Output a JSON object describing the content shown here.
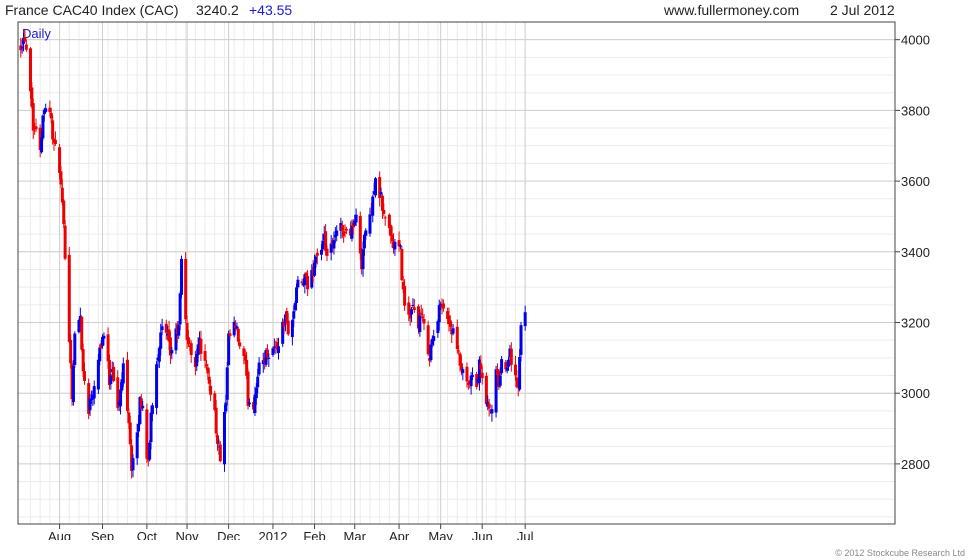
{
  "header": {
    "name": "France CAC40 Index (CAC)",
    "value": "3240.2",
    "change": "+43.55",
    "site": "www.fullermoney.com",
    "date": "2 Jul 2012"
  },
  "footer": {
    "credit": "© 2012 Stockcube Research Ltd"
  },
  "colors": {
    "up": "#0000ee",
    "down": "#ee0000",
    "grid": "#cfcfcf",
    "axis": "#444444",
    "label_blue": "#1a1acc"
  },
  "chart_data": {
    "type": "candlestick",
    "frequency_label": "Daily",
    "y_ticks": [
      "4000",
      "3800",
      "3600",
      "3400",
      "3200",
      "3000",
      "2800"
    ],
    "ylim": [
      2630,
      4050
    ],
    "x_ticks": [
      "Aug",
      "Sep",
      "Oct",
      "Nov",
      "Dec",
      "2012",
      "Feb",
      "Mar",
      "Apr",
      "May",
      "Jun",
      "Jul"
    ],
    "x_tick_dates": [
      "2011-08-01",
      "2011-09-01",
      "2011-10-03",
      "2011-11-01",
      "2011-12-01",
      "2012-01-02",
      "2012-02-01",
      "2012-03-01",
      "2012-04-02",
      "2012-05-02",
      "2012-06-01",
      "2012-07-02"
    ],
    "grid": true,
    "y_axis_side": "right",
    "close_path": [
      [
        "2011-07-04",
        3990
      ],
      [
        "2011-07-07",
        4010
      ],
      [
        "2011-07-11",
        3870
      ],
      [
        "2011-07-13",
        3760
      ],
      [
        "2011-07-18",
        3700
      ],
      [
        "2011-07-21",
        3820
      ],
      [
        "2011-07-25",
        3800
      ],
      [
        "2011-07-28",
        3700
      ],
      [
        "2011-08-01",
        3640
      ],
      [
        "2011-08-03",
        3520
      ],
      [
        "2011-08-05",
        3400
      ],
      [
        "2011-08-08",
        3160
      ],
      [
        "2011-08-10",
        3000
      ],
      [
        "2011-08-12",
        3160
      ],
      [
        "2011-08-16",
        3220
      ],
      [
        "2011-08-18",
        3060
      ],
      [
        "2011-08-22",
        2960
      ],
      [
        "2011-08-25",
        3010
      ],
      [
        "2011-08-30",
        3130
      ],
      [
        "2011-09-02",
        3170
      ],
      [
        "2011-09-06",
        3040
      ],
      [
        "2011-09-08",
        3080
      ],
      [
        "2011-09-12",
        2950
      ],
      [
        "2011-09-14",
        3000
      ],
      [
        "2011-09-16",
        3080
      ],
      [
        "2011-09-20",
        2930
      ],
      [
        "2011-09-22",
        2790
      ],
      [
        "2011-09-26",
        2870
      ],
      [
        "2011-09-28",
        2980
      ],
      [
        "2011-09-30",
        2960
      ],
      [
        "2011-10-04",
        2790
      ],
      [
        "2011-10-06",
        2940
      ],
      [
        "2011-10-10",
        3090
      ],
      [
        "2011-10-12",
        3140
      ],
      [
        "2011-10-14",
        3180
      ],
      [
        "2011-10-18",
        3150
      ],
      [
        "2011-10-20",
        3110
      ],
      [
        "2011-10-24",
        3170
      ],
      [
        "2011-10-26",
        3180
      ],
      [
        "2011-10-28",
        3370
      ],
      [
        "2011-11-01",
        3160
      ],
      [
        "2011-11-03",
        3120
      ],
      [
        "2011-11-07",
        3090
      ],
      [
        "2011-11-09",
        3150
      ],
      [
        "2011-11-11",
        3130
      ],
      [
        "2011-11-15",
        3060
      ],
      [
        "2011-11-17",
        3030
      ],
      [
        "2011-11-21",
        2950
      ],
      [
        "2011-11-23",
        2850
      ],
      [
        "2011-11-25",
        2820
      ],
      [
        "2011-11-29",
        2970
      ],
      [
        "2011-12-01",
        3150
      ],
      [
        "2011-12-05",
        3190
      ],
      [
        "2011-12-07",
        3170
      ],
      [
        "2011-12-09",
        3130
      ],
      [
        "2011-12-13",
        3080
      ],
      [
        "2011-12-15",
        2980
      ],
      [
        "2011-12-19",
        2970
      ],
      [
        "2011-12-21",
        3030
      ],
      [
        "2011-12-23",
        3070
      ],
      [
        "2011-12-28",
        3110
      ],
      [
        "2012-01-03",
        3130
      ],
      [
        "2012-01-05",
        3130
      ],
      [
        "2012-01-09",
        3190
      ],
      [
        "2012-01-11",
        3210
      ],
      [
        "2012-01-13",
        3180
      ],
      [
        "2012-01-17",
        3220
      ],
      [
        "2012-01-19",
        3300
      ],
      [
        "2012-01-23",
        3310
      ],
      [
        "2012-01-25",
        3320
      ],
      [
        "2012-01-27",
        3300
      ],
      [
        "2012-01-31",
        3350
      ],
      [
        "2012-02-02",
        3390
      ],
      [
        "2012-02-06",
        3400
      ],
      [
        "2012-02-08",
        3430
      ],
      [
        "2012-02-10",
        3390
      ],
      [
        "2012-02-14",
        3410
      ],
      [
        "2012-02-16",
        3440
      ],
      [
        "2012-02-20",
        3470
      ],
      [
        "2012-02-22",
        3460
      ],
      [
        "2012-02-24",
        3450
      ],
      [
        "2012-02-28",
        3470
      ],
      [
        "2012-03-02",
        3490
      ],
      [
        "2012-03-06",
        3370
      ],
      [
        "2012-03-08",
        3450
      ],
      [
        "2012-03-12",
        3490
      ],
      [
        "2012-03-14",
        3570
      ],
      [
        "2012-03-16",
        3590
      ],
      [
        "2012-03-20",
        3550
      ],
      [
        "2012-03-22",
        3500
      ],
      [
        "2012-03-26",
        3470
      ],
      [
        "2012-03-28",
        3420
      ],
      [
        "2012-03-30",
        3420
      ],
      [
        "2012-04-03",
        3400
      ],
      [
        "2012-04-05",
        3280
      ],
      [
        "2012-04-10",
        3200
      ],
      [
        "2012-04-12",
        3240
      ],
      [
        "2012-04-16",
        3200
      ],
      [
        "2012-04-18",
        3220
      ],
      [
        "2012-04-20",
        3180
      ],
      [
        "2012-04-24",
        3110
      ],
      [
        "2012-04-26",
        3150
      ],
      [
        "2012-04-30",
        3200
      ],
      [
        "2012-05-02",
        3270
      ],
      [
        "2012-05-04",
        3240
      ],
      [
        "2012-05-08",
        3200
      ],
      [
        "2012-05-10",
        3180
      ],
      [
        "2012-05-14",
        3120
      ],
      [
        "2012-05-16",
        3080
      ],
      [
        "2012-05-18",
        3050
      ],
      [
        "2012-05-22",
        3010
      ],
      [
        "2012-05-24",
        3040
      ],
      [
        "2012-05-28",
        3020
      ],
      [
        "2012-05-30",
        3080
      ],
      [
        "2012-06-01",
        3040
      ],
      [
        "2012-06-05",
        2960
      ],
      [
        "2012-06-07",
        2940
      ],
      [
        "2012-06-11",
        3050
      ],
      [
        "2012-06-13",
        3030
      ],
      [
        "2012-06-15",
        3080
      ],
      [
        "2012-06-19",
        3090
      ],
      [
        "2012-06-21",
        3120
      ],
      [
        "2012-06-25",
        3040
      ],
      [
        "2012-06-27",
        3010
      ],
      [
        "2012-06-29",
        3190
      ],
      [
        "2012-07-02",
        3240
      ]
    ]
  }
}
